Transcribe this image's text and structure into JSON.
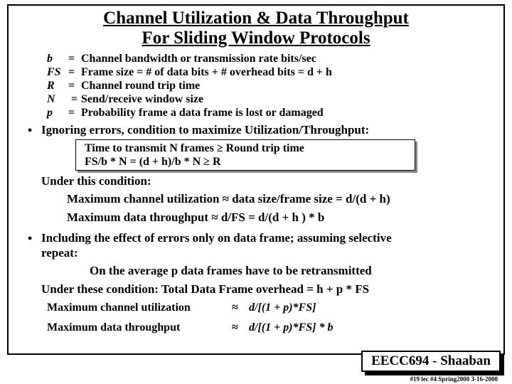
{
  "title": {
    "line1": "Channel Utilization & Data Throughput",
    "line2": "For Sliding Window Protocols"
  },
  "definitions": [
    {
      "sym": "b",
      "text": "Channel bandwidth or transmission rate bits/sec"
    },
    {
      "sym": "FS",
      "text": "Frame size   =    # of data bits   +    # overhead bits  =  d  +  h"
    },
    {
      "sym": "R",
      "text": "Channel round trip time"
    },
    {
      "sym": "N",
      "text": "Send/receive window size"
    },
    {
      "sym": "p",
      "text": "Probability frame  a data frame is lost or damaged"
    }
  ],
  "sec1": {
    "lead": "Ignoring errors, condition to maximize Utilization/Throughput:",
    "box": {
      "l1": "Time to transmit N frames      ≥     Round trip time",
      "l2": "FS/b * N  =  (d + h)/b  *  N        ≥     R"
    },
    "under": "Under this condition:",
    "u1": "Maximum channel utilization   ≈   data size/frame size   =  d/(d + h)",
    "u2": "Maximum data throughput       ≈   d/FS  =  d/(d  + h )  *  b"
  },
  "sec2": {
    "lead1": "Including the effect of errors only on data frame; assuming selective",
    "lead2": "repeat:",
    "avg": "On the average  p  data frames have to be retransmitted",
    "under": "Under these condition:     Total Data Frame overhead  =  h  +  p * FS",
    "rows": [
      {
        "label": "Maximum channel utilization",
        "sym": "≈",
        "expr": "d/[(1 + p)*FS]"
      },
      {
        "label": "Maximum data throughput",
        "sym": "≈",
        "expr": "d/[(1 + p)*FS]  * b"
      }
    ]
  },
  "stamp": "EECC694 - Shaaban",
  "footer": "#19  lec #4   Spring2000   3-16-2000"
}
